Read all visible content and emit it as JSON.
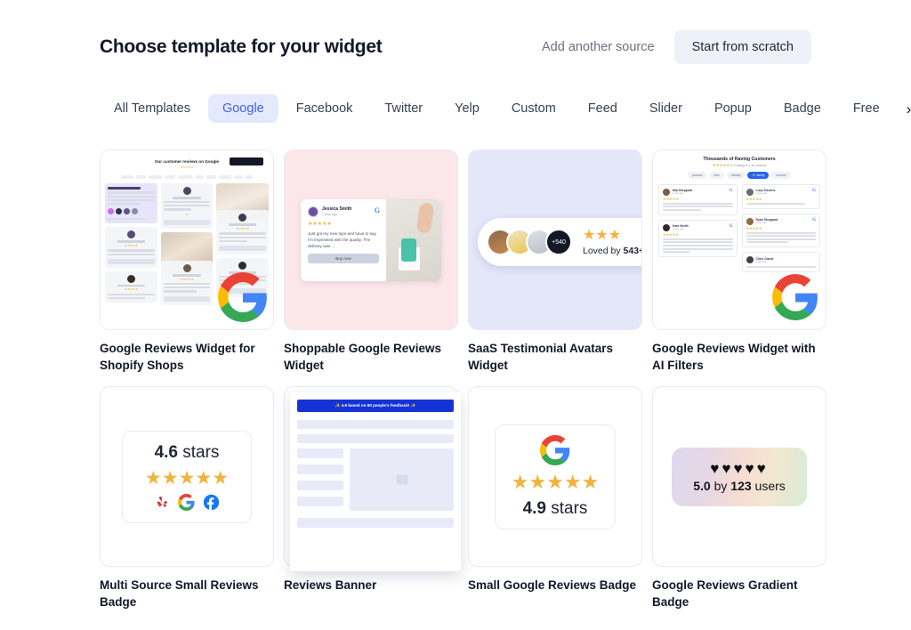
{
  "header": {
    "title": "Choose template for your widget",
    "add_source_label": "Add another source",
    "scratch_label": "Start from scratch"
  },
  "tabs": {
    "items": [
      {
        "label": "All Templates",
        "active": false
      },
      {
        "label": "Google",
        "active": true
      },
      {
        "label": "Facebook",
        "active": false
      },
      {
        "label": "Twitter",
        "active": false
      },
      {
        "label": "Yelp",
        "active": false
      },
      {
        "label": "Custom",
        "active": false
      },
      {
        "label": "Feed",
        "active": false
      },
      {
        "label": "Slider",
        "active": false
      },
      {
        "label": "Popup",
        "active": false
      },
      {
        "label": "Badge",
        "active": false
      },
      {
        "label": "Free",
        "active": false
      }
    ],
    "next_icon": "›",
    "active_color": "#4460e8",
    "active_bg": "#e4e9fd"
  },
  "templates": [
    {
      "label": "Google Reviews Widget for Shopify Shops"
    },
    {
      "label": "Shoppable Google Reviews Widget"
    },
    {
      "label": "SaaS Testimonial Avatars Widget"
    },
    {
      "label": "Google Reviews Widget with AI Filters"
    },
    {
      "label": "Multi Source Small Reviews Badge"
    },
    {
      "label": "Reviews Banner"
    },
    {
      "label": "Small Google Reviews Badge"
    },
    {
      "label": "Google Reviews Gradient Badge"
    }
  ],
  "card1": {
    "title": "Our customer reviews on Google",
    "subtitle": "4.9 rating of 1.2k reviews",
    "stars": "★★★★★",
    "button_label": "Review us"
  },
  "card2": {
    "reviewer": "Jessica Smith",
    "time": "1 year ago",
    "stars": "★★★★★",
    "text": "Just got my new tops and have to say I'm impressed with the quality. The delivery was ...",
    "buy_label": "Buy now",
    "source_icon": "G",
    "background": "#fbe7ea"
  },
  "card3": {
    "avatar_count_label": "+540",
    "stars": "★★★",
    "loved_prefix": "Loved by ",
    "loved_count": "543+",
    "background": "#e4e6fa"
  },
  "card4": {
    "title": "Thousands of Raving Customers",
    "subtitle": "4.9 rating of 1.2k reviews",
    "stars": "★★★★★",
    "filters": [
      {
        "label": "product",
        "active": false
      },
      {
        "label": "new",
        "active": false
      },
      {
        "label": "holiday",
        "active": false
      },
      {
        "label": "✨ family",
        "active": true
      },
      {
        "label": "number",
        "active": false
      }
    ],
    "reviews": [
      {
        "name": "Mia Sheppard",
        "time": "1 year ago",
        "stars": "★★★★★"
      },
      {
        "name": "Lucy Stevens",
        "time": "1 year ago",
        "stars": "★★★★★"
      },
      {
        "name": "Kate Smith",
        "time": "1 year ago",
        "stars": "★★★★★"
      },
      {
        "name": "Ryan Sheppard",
        "time": "1 year ago",
        "stars": "★★★★★"
      },
      {
        "name": "Chris Clarke",
        "time": "1 year ago",
        "stars": "★★★★★"
      }
    ]
  },
  "card5": {
    "rating": "4.6",
    "unit": " stars",
    "stars": "★★★★★",
    "sources": [
      "yelp-logo",
      "google-logo",
      "facebook-logo"
    ]
  },
  "card6": {
    "banner_text": "✨ 4.9 based on 80 people's feedback! ✨",
    "banner_color": "#1433d4"
  },
  "card7": {
    "rating": "4.9",
    "unit": " stars",
    "stars": "★★★★★",
    "source_icon": "google-logo"
  },
  "card8": {
    "hearts": "♥♥♥♥♥",
    "rating": "5.0",
    "middle": " by ",
    "count": "123",
    "suffix": " users"
  }
}
